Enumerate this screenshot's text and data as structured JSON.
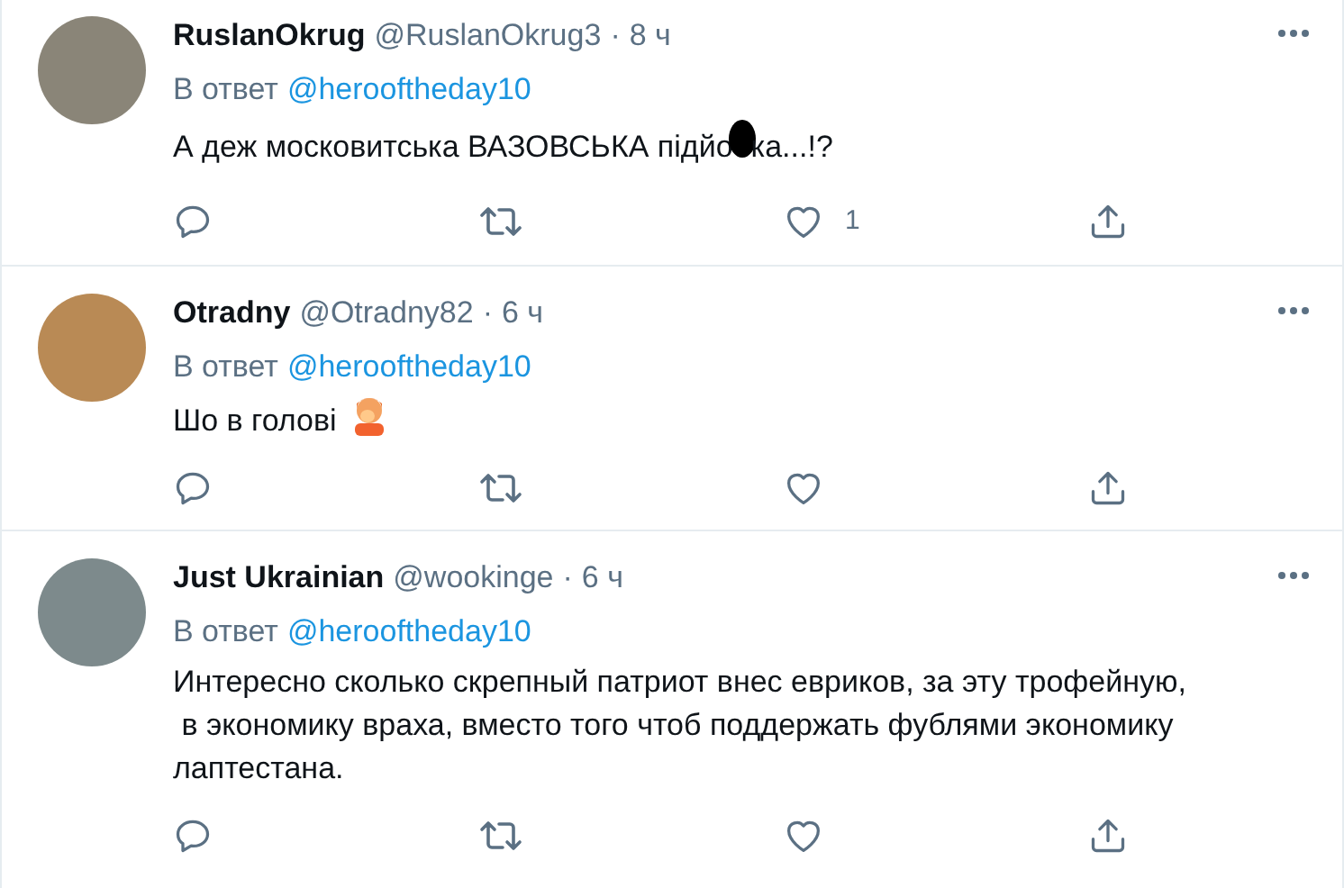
{
  "tweets": [
    {
      "name": "RuslanOkrug",
      "handle": "@RuslanOkrug3",
      "separator": "·",
      "time": "8 ч",
      "reply_label": "В ответ",
      "reply_to": "@herooftheday10",
      "text": "А деж московитська ВАЗОВСЬКА підйо",
      "text_after_blot": "ка...!?",
      "has_emoji": false,
      "likes": "1"
    },
    {
      "name": "Otradny",
      "handle": "@Otradny82",
      "separator": "·",
      "time": "6 ч",
      "reply_label": "В ответ",
      "reply_to": "@herooftheday10",
      "text": "Шо в голові",
      "has_emoji": true
    },
    {
      "name": "Just Ukrainian",
      "handle": "@wookinge",
      "separator": "·",
      "time": "6 ч",
      "reply_label": "В ответ",
      "reply_to": "@herooftheday10",
      "text": "Интересно сколько скрепный патриот внес евриков, за эту трофейную,\n в экономику враха, вместо того чтоб поддержать фублями экономику лаптестана.",
      "has_emoji": false
    }
  ]
}
